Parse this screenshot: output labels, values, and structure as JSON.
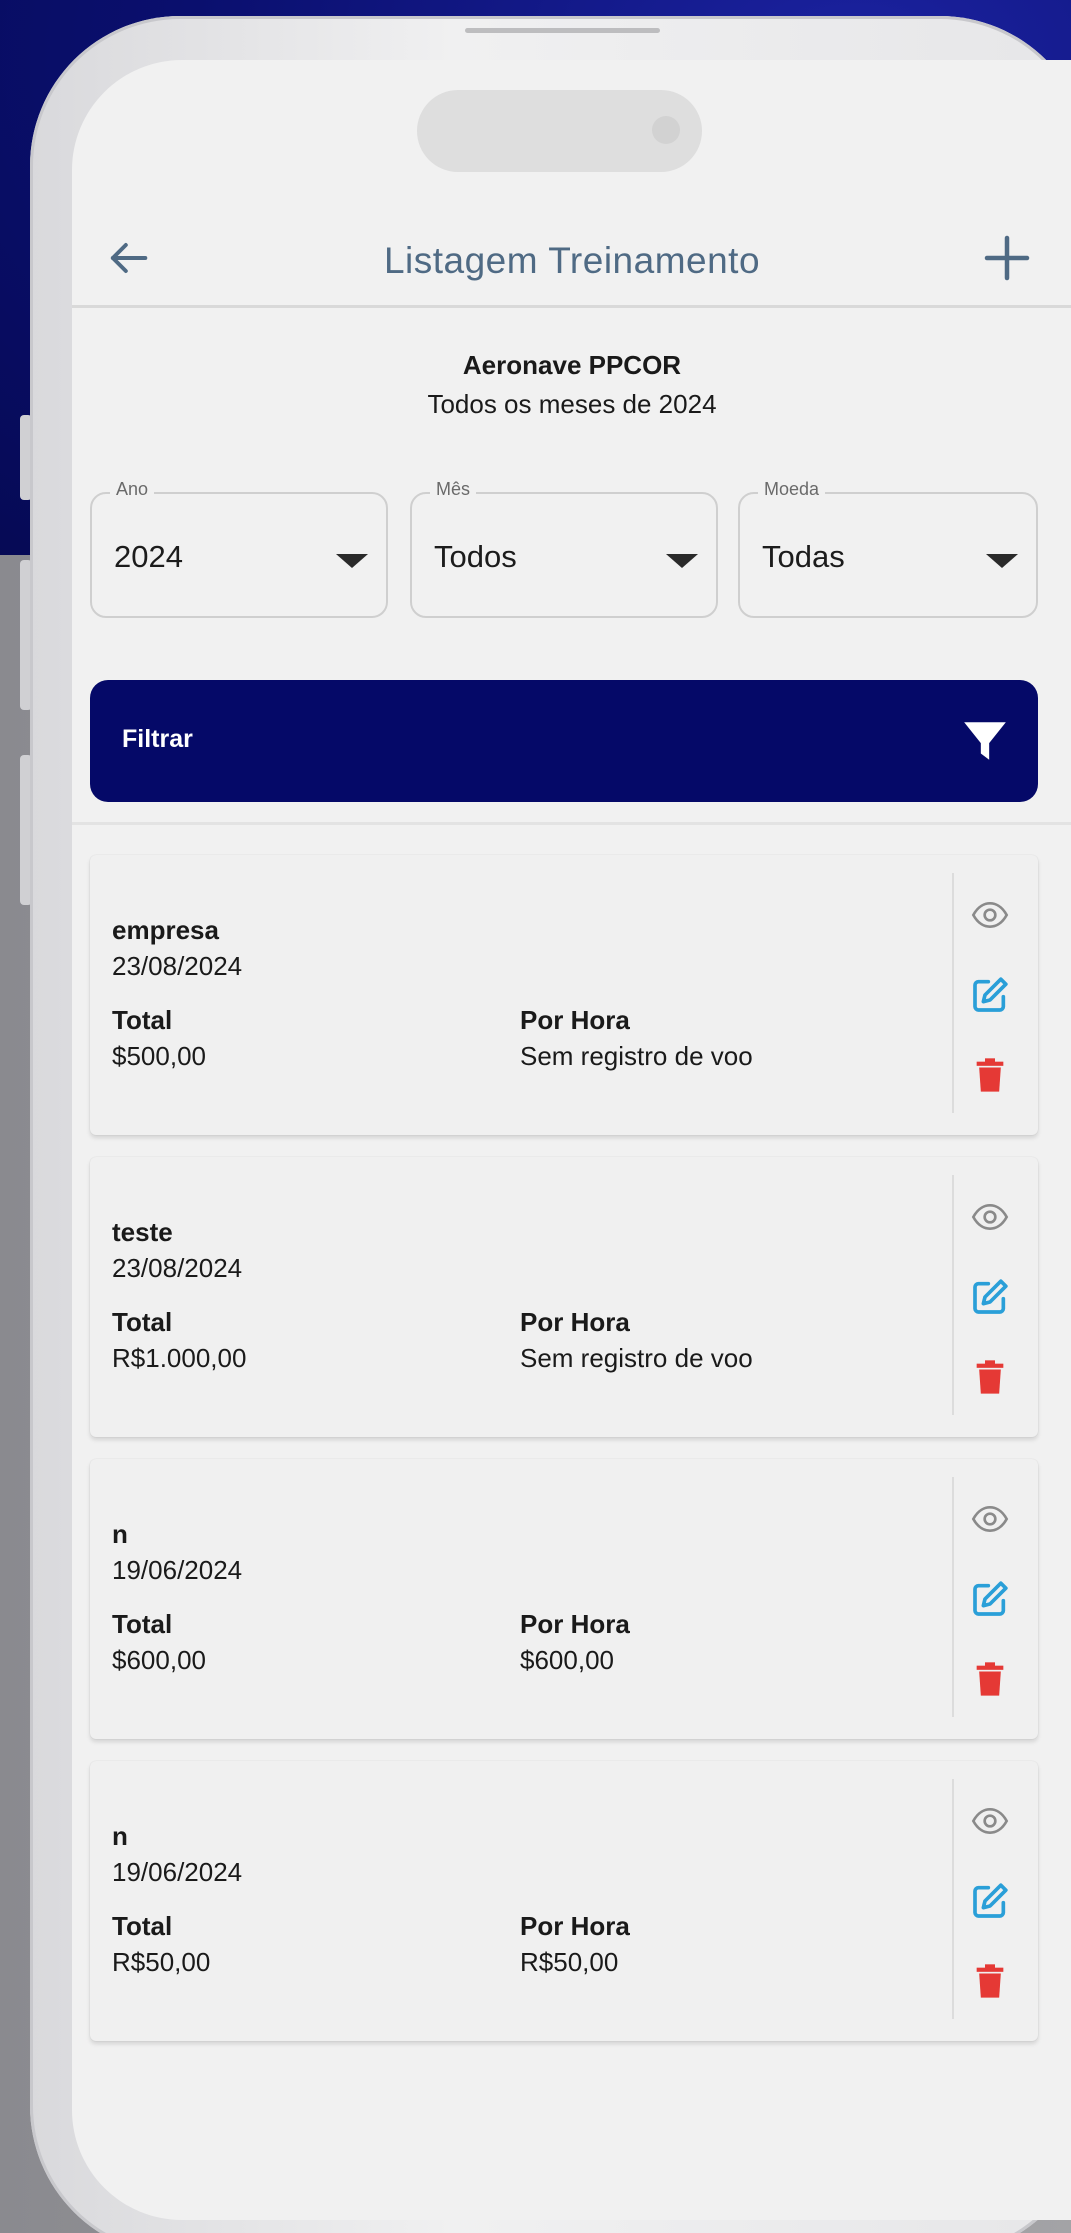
{
  "header": {
    "title": "Listagem Treinamento"
  },
  "summary": {
    "aircraft": "Aeronave PPCOR",
    "period": "Todos os meses de 2024"
  },
  "filters": {
    "year": {
      "label": "Ano",
      "value": "2024"
    },
    "month": {
      "label": "Mês",
      "value": "Todos"
    },
    "currency": {
      "label": "Moeda",
      "value": "Todas"
    },
    "apply_label": "Filtrar"
  },
  "colors": {
    "primary": "#050968",
    "accent_blue": "#2a9fd8",
    "danger": "#e53935",
    "title_gray": "#4f6a84"
  },
  "records": [
    {
      "name": "empresa",
      "date": "23/08/2024",
      "total_label": "Total",
      "total": "$500,00",
      "hour_label": "Por Hora",
      "per_hour": "Sem registro de voo"
    },
    {
      "name": "teste",
      "date": "23/08/2024",
      "total_label": "Total",
      "total": "R$1.000,00",
      "hour_label": "Por Hora",
      "per_hour": "Sem registro de voo"
    },
    {
      "name": "n",
      "date": "19/06/2024",
      "total_label": "Total",
      "total": "$600,00",
      "hour_label": "Por Hora",
      "per_hour": "$600,00"
    },
    {
      "name": "n",
      "date": "19/06/2024",
      "total_label": "Total",
      "total": "R$50,00",
      "hour_label": "Por Hora",
      "per_hour": "R$50,00"
    }
  ]
}
